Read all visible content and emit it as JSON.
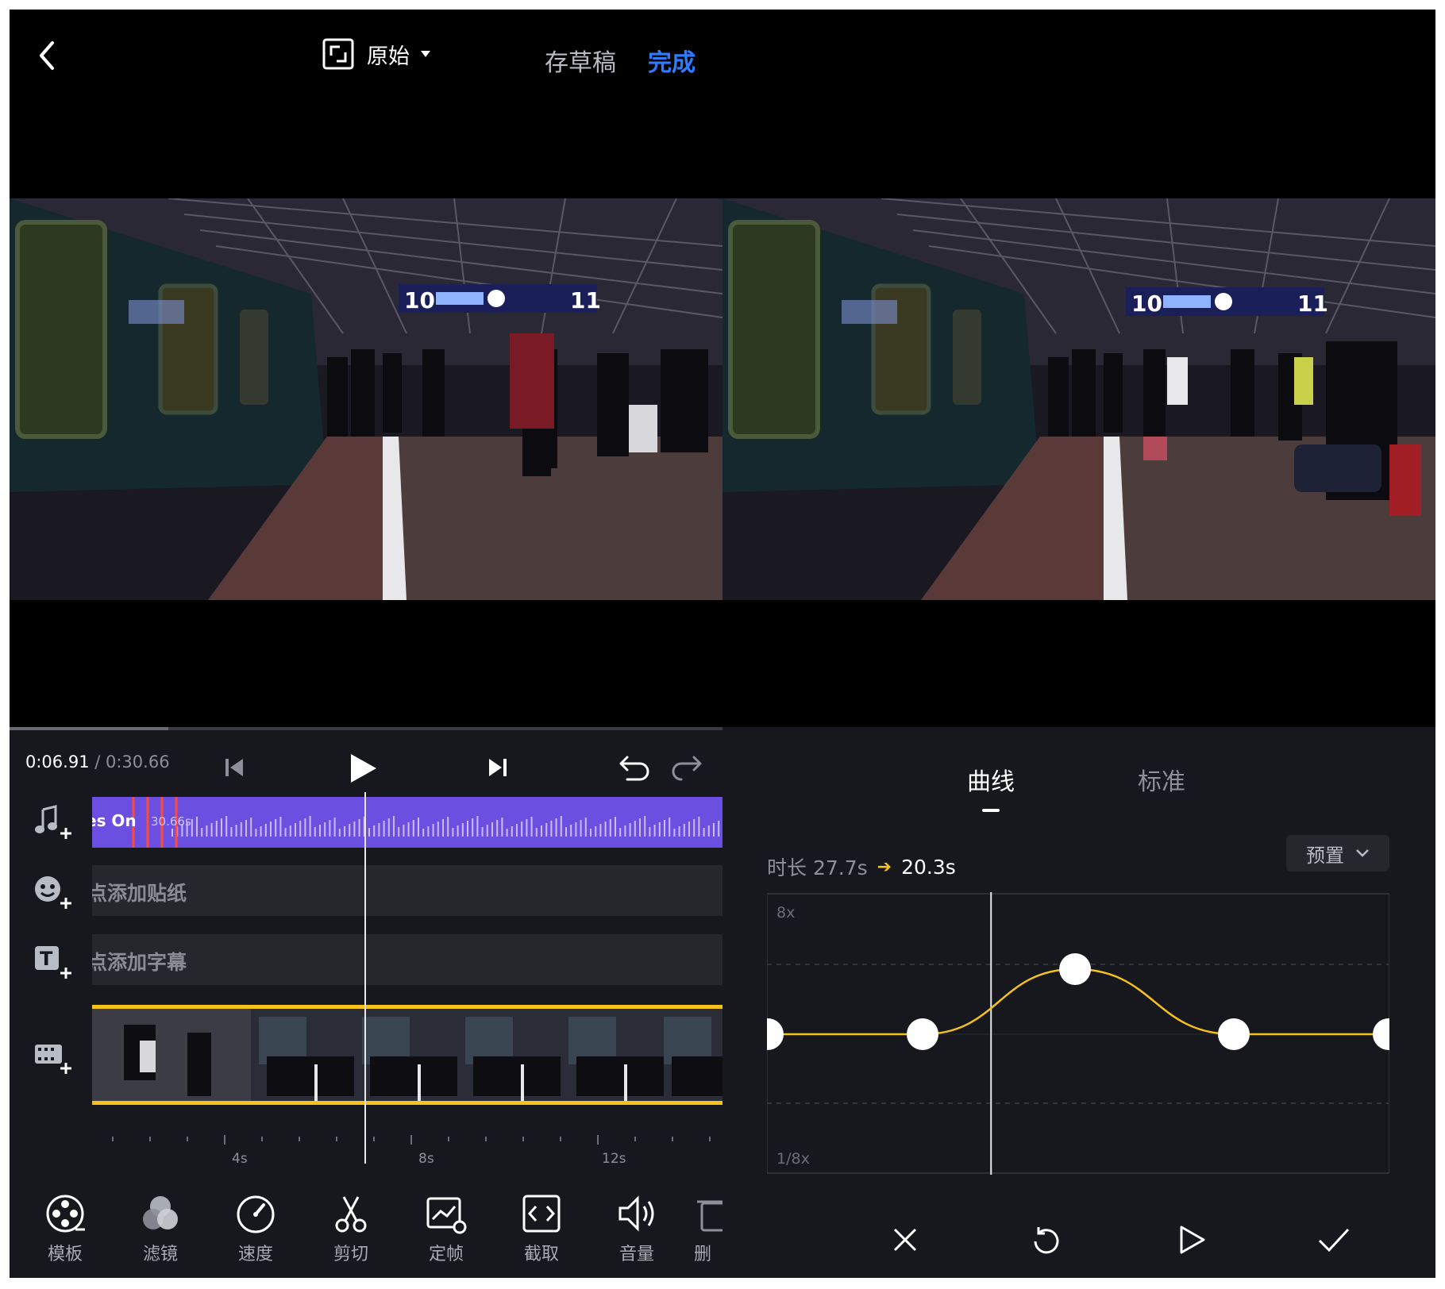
{
  "header": {
    "back_icon": "chevron-left-icon",
    "ratio_label": "原始",
    "draft_label": "存草稿",
    "done_label": "完成",
    "done_color": "#2f7bff"
  },
  "left_editor": {
    "current_time": "0:06.91",
    "total_time": "/ 0:30.66",
    "music_track": {
      "label": "es On",
      "duration": "30.66s",
      "color": "#6a4fe0"
    },
    "sticker_track_label": "点添加贴纸",
    "caption_track_label": "点添加字幕",
    "ruler_labels": [
      "4s",
      "8s",
      "12s"
    ],
    "tools": [
      {
        "label": "模板",
        "icon": "template-icon"
      },
      {
        "label": "滤镜",
        "icon": "filter-icon"
      },
      {
        "label": "速度",
        "icon": "speed-icon"
      },
      {
        "label": "剪切",
        "icon": "scissors-icon"
      },
      {
        "label": "定帧",
        "icon": "freeze-frame-icon"
      },
      {
        "label": "截取",
        "icon": "crop-icon"
      },
      {
        "label": "音量",
        "icon": "volume-icon"
      },
      {
        "label": "删",
        "icon": "trash-icon"
      }
    ]
  },
  "speed_panel": {
    "tabs": [
      {
        "label": "曲线",
        "active": true
      },
      {
        "label": "标准",
        "active": false
      }
    ],
    "duration_prefix": "时长 27.7s",
    "duration_new": "20.3s",
    "preset_label": "预置",
    "y_top_label": "8x",
    "y_bottom_label": "1/8x",
    "curve_color": "#f4c21a",
    "playhead_position": 0.36,
    "control_points": [
      {
        "t": 0.0,
        "speed": "1x"
      },
      {
        "t": 0.25,
        "speed": "1x"
      },
      {
        "t": 0.495,
        "speed": "2x"
      },
      {
        "t": 0.75,
        "speed": "1x"
      },
      {
        "t": 1.0,
        "speed": "1x"
      }
    ],
    "actions": [
      "close-icon",
      "reset-icon",
      "play-icon",
      "confirm-icon"
    ]
  }
}
